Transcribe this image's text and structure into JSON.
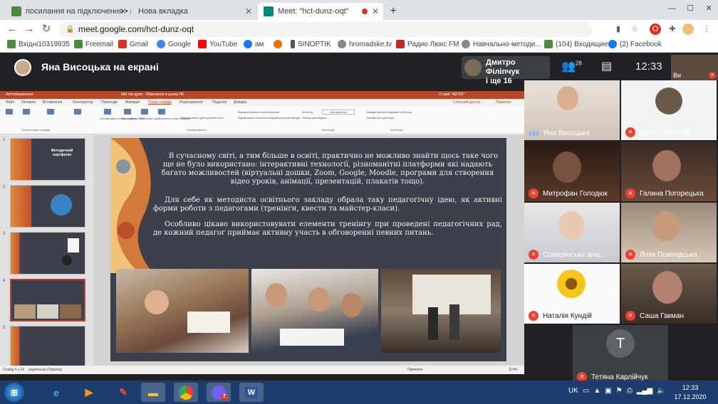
{
  "browser": {
    "tabs": [
      {
        "title": "посилання на підключення • пе",
        "active": false
      },
      {
        "title": "Нова вкладка",
        "active": false
      },
      {
        "title": "Meet: \"hct-dunz-oqt\"",
        "active": true
      }
    ],
    "url": "meet.google.com/hct-dunz-oqt",
    "bookmarks": [
      {
        "label": "Вхідні10319935",
        "icon": "bookmark-icon",
        "color": "#4b8b3b"
      },
      {
        "label": "Freemail",
        "icon": "freemail-icon",
        "color": "#4b8b3b"
      },
      {
        "label": "Gmail",
        "icon": "gmail-icon",
        "color": "#d93025"
      },
      {
        "label": "Google",
        "icon": "google-icon",
        "color": "#4285f4"
      },
      {
        "label": "YouTube",
        "icon": "youtube-icon",
        "color": "#ff0000"
      },
      {
        "label": "ам",
        "icon": "facebook-icon",
        "color": "#1877f2"
      },
      {
        "label": "",
        "icon": "orange-circle-icon",
        "color": "#e8710a"
      },
      {
        "label": "SINOPTIK",
        "icon": "sinoptik-icon",
        "color": "#555555"
      },
      {
        "label": "hromadske.tv",
        "icon": "globe-icon",
        "color": "#888888"
      },
      {
        "label": "Радио Люкс FM",
        "icon": "radio-icon",
        "color": "#c62828"
      },
      {
        "label": "Навчально-методи...",
        "icon": "globe-icon",
        "color": "#888888"
      },
      {
        "label": "(104) Входящие",
        "icon": "mail-icon",
        "color": "#4b8b3b"
      },
      {
        "label": "(2) Facebook",
        "icon": "facebook-icon",
        "color": "#1877f2"
      }
    ]
  },
  "meet": {
    "presenting_title": "Яна Висоцька на екрані",
    "pinned": {
      "name": "Дмитро Філіпчук",
      "extra": "і ще 16"
    },
    "people_count": "28",
    "time": "12:33",
    "self_label": "Ви",
    "participants": [
      {
        "name": "Яна Висоцька",
        "muted": false
      },
      {
        "name": "Лідія Симонова",
        "muted": true
      },
      {
        "name": "Митрофан Голодюк",
        "muted": true
      },
      {
        "name": "Галина Погорецька",
        "muted": true
      },
      {
        "name": "Сокирянське вищ...",
        "muted": true
      },
      {
        "name": "Лілія Пшегодська",
        "muted": true
      },
      {
        "name": "Наталія Кундій",
        "muted": true
      },
      {
        "name": "Саша Гакман",
        "muted": true
      },
      {
        "name": "Тетяна Карлійчук",
        "muted": true,
        "initial": "T"
      }
    ]
  },
  "ppt": {
    "title_left": "Автозбереження",
    "title_center": "Мій тип дуже - Збережено в цьому ПК",
    "title_right": "Сторій \"ЧЕПУК\"",
    "tabs": [
      "Файл",
      "Основне",
      "Вставлення",
      "Конструктор",
      "Переходи",
      "Анімація",
      "Показ слайдів",
      "Рецензування",
      "Подання",
      "Довідка"
    ],
    "active_tab": "Показ слайдів",
    "share_label": "Спільний доступ",
    "notes_label": "Примітки",
    "ribbon_groups": [
      "Почати показ слайдів",
      "Налаштування",
      "Монітори",
      "Субтитри"
    ],
    "ribbon_options": [
      "Налаштувати показ слайдів",
      "Приховати слайд",
      "Репетиція часу",
      "Записати показ слайдів",
      "Відтворювати дикторський текст",
      "Використовувати хронометраж",
      "Відображати елементи керування мультимедіа",
      "Монітор:",
      "Автоматично",
      "Режим доповідача",
      "Завжди використовувати субтитри",
      "Параметри субтитрів"
    ],
    "slide_numbers": [
      "1",
      "2",
      "3",
      "4",
      "5"
    ],
    "thumb1_title": "Методичний портфоліо",
    "slide_paragraphs": [
      "В сучасному світі, а тим більше в освіті, практично не можливо знайти щось таке чого ще не було використано: інтерактивні технології, різноманітні платформи які надають багато можливостей (віртуальні дошки, Zoom, Google, Moodle, програми для створення відео уроків, анімації, презентацій, плакатів тощо).",
      "Для себе як методиста освітнього закладу обрала таку педагогічну ідею, як активні форми роботи з педагогами (тренінги, квести та майстер-класи).",
      "Особливо цікаво використовувати елементи тренінгу при проведені педагогічних рад, де кожний педагог приймає активну участь в обговоренні певних питань."
    ],
    "status_left": "Слайд 4 з 14",
    "status_lang": "українська (Україна)",
    "status_notes": "Примітки",
    "zoom": "114%"
  },
  "taskbar": {
    "lang": "UK",
    "time": "12:33",
    "date": "17.12.2020",
    "viber_badge": "7"
  },
  "colors": {
    "ppt_accent": "#b7472a",
    "meet_bg": "#202124",
    "mute_red": "#ea4335"
  }
}
